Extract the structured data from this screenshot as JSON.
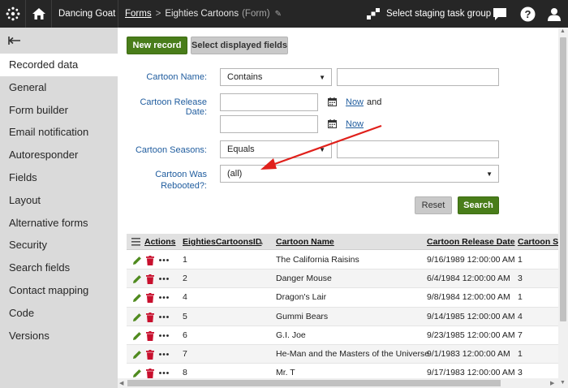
{
  "topbar": {
    "site_name": "Dancing Goat",
    "breadcrumb_root": "Forms",
    "breadcrumb_page": "Eighties Cartoons",
    "breadcrumb_type": "(Form)",
    "staging_label": "Select staging task group"
  },
  "sidebar": {
    "items": [
      {
        "label": "Recorded data"
      },
      {
        "label": "General"
      },
      {
        "label": "Form builder"
      },
      {
        "label": "Email notification"
      },
      {
        "label": "Autoresponder"
      },
      {
        "label": "Fields"
      },
      {
        "label": "Layout"
      },
      {
        "label": "Alternative forms"
      },
      {
        "label": "Security"
      },
      {
        "label": "Search fields"
      },
      {
        "label": "Contact mapping"
      },
      {
        "label": "Code"
      },
      {
        "label": "Versions"
      }
    ]
  },
  "toolbar": {
    "new_record": "New record",
    "select_fields": "Select displayed fields"
  },
  "filter": {
    "name_label": "Cartoon Name:",
    "name_operator": "Contains",
    "name_value": "",
    "date_label": "Cartoon Release Date:",
    "date_from": "",
    "date_to": "",
    "now_label": "Now",
    "and_label": "and",
    "seasons_label": "Cartoon Seasons:",
    "seasons_operator": "Equals",
    "seasons_value": "",
    "rebooted_label_1": "Cartoon Was",
    "rebooted_label_2": "Rebooted?:",
    "rebooted_value": "(all)",
    "reset": "Reset",
    "search": "Search"
  },
  "grid": {
    "columns": [
      "Actions",
      "EightiesCartoonsID",
      "Cartoon Name",
      "Cartoon Release Date",
      "Cartoon Se"
    ],
    "rows": [
      {
        "id": "1",
        "name": "The California Raisins",
        "date": "9/16/1989 12:00:00 AM",
        "seasons": "1"
      },
      {
        "id": "2",
        "name": "Danger Mouse",
        "date": "6/4/1984 12:00:00 AM",
        "seasons": "3"
      },
      {
        "id": "4",
        "name": "Dragon's Lair",
        "date": "9/8/1984 12:00:00 AM",
        "seasons": "1"
      },
      {
        "id": "5",
        "name": "Gummi Bears",
        "date": "9/14/1985 12:00:00 AM",
        "seasons": "4"
      },
      {
        "id": "6",
        "name": "G.I. Joe",
        "date": "9/23/1985 12:00:00 AM",
        "seasons": "7"
      },
      {
        "id": "7",
        "name": "He-Man and the Masters of the Universe",
        "date": "9/1/1983 12:00:00 AM",
        "seasons": "1"
      },
      {
        "id": "8",
        "name": "Mr. T",
        "date": "9/17/1983 12:00:00 AM",
        "seasons": "3"
      }
    ]
  },
  "colors": {
    "accent_green": "#497d1a",
    "link_blue": "#1f5c9e",
    "delete_red": "#c8102e",
    "annotation_red": "#e0201b"
  }
}
